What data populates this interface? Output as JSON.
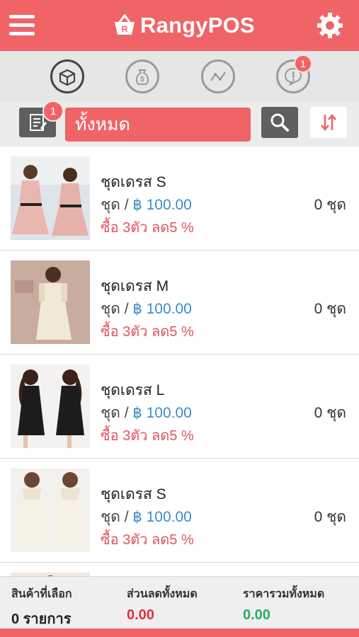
{
  "app": {
    "brand": "RangyPOS",
    "accent_color": "#f06468",
    "icons": {
      "menu": "hamburger-icon",
      "settings": "gear-icon"
    }
  },
  "tabs": [
    {
      "icon": "box-icon",
      "active": true
    },
    {
      "icon": "money-bag-icon",
      "active": false
    },
    {
      "icon": "chart-line-icon",
      "active": false
    },
    {
      "icon": "alert-bubble-icon",
      "active": false,
      "badge": "1"
    }
  ],
  "filter": {
    "notes_badge": "1",
    "category": "ทั้งหมด",
    "icons": {
      "notes": "notes-icon",
      "search": "search-icon",
      "sort": "sort-icon"
    }
  },
  "products": [
    {
      "name": "ชุดเดรส S",
      "unit": "ชุด / ",
      "price": "฿ 100.00",
      "promo": "ซื้อ 3ตัว ลด5 %",
      "stock": "0 ชุด",
      "image": "pink-dress-photo"
    },
    {
      "name": "ชุดเดรส M",
      "unit": "ชุด / ",
      "price": "฿ 100.00",
      "promo": "ซื้อ 3ตัว ลด5 %",
      "stock": "0 ชุด",
      "image": "cream-dress-photo"
    },
    {
      "name": "ชุดเดรส L",
      "unit": "ชุด / ",
      "price": "฿ 100.00",
      "promo": "ซื้อ 3ตัว ลด5 %",
      "stock": "0 ชุด",
      "image": "black-dress-photo"
    },
    {
      "name": "ชุดเดรส S",
      "unit": "ชุด / ",
      "price": "฿ 100.00",
      "promo": "ซื้อ 3ตัว ลด5 %",
      "stock": "0 ชุด",
      "image": "white-dress-photo"
    }
  ],
  "summary": {
    "selected_label": "สินค้าที่เลือก",
    "selected_value": "0 รายการ",
    "discount_label": "ส่วนลดทั้งหมด",
    "discount_value": "0.00",
    "discount_color": "#e0303c",
    "total_label": "ราคารวมทั้งหมด",
    "total_value": "0.00",
    "total_color": "#27ae60"
  }
}
